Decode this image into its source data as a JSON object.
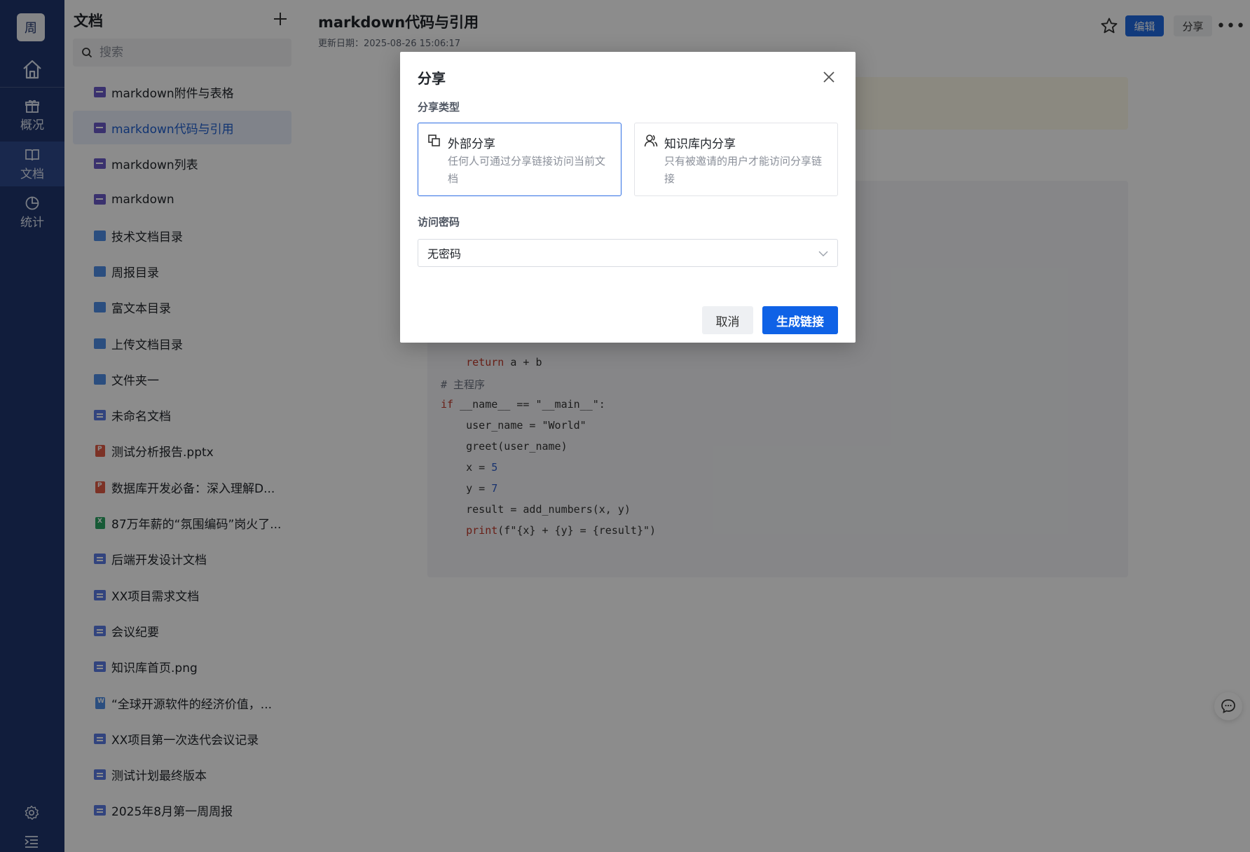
{
  "rail": {
    "avatar_text": "周",
    "nav": [
      {
        "label": "概况",
        "icon": "gift-icon"
      },
      {
        "label": "文档",
        "icon": "book-icon",
        "active": true
      },
      {
        "label": "统计",
        "icon": "pie-chart-icon"
      }
    ]
  },
  "panel": {
    "title": "文档",
    "search_placeholder": "搜索",
    "items": [
      {
        "label": "markdown附件与表格",
        "type": "md"
      },
      {
        "label": "markdown代码与引用",
        "type": "md",
        "active": true
      },
      {
        "label": "markdown列表",
        "type": "md"
      },
      {
        "label": "markdown",
        "type": "md"
      },
      {
        "label": "技术文档目录",
        "type": "folder"
      },
      {
        "label": "周报目录",
        "type": "folder"
      },
      {
        "label": "富文本目录",
        "type": "folder"
      },
      {
        "label": "上传文档目录",
        "type": "folder"
      },
      {
        "label": "文件夹一",
        "type": "folder"
      },
      {
        "label": "未命名文档",
        "type": "doc"
      },
      {
        "label": "测试分析报告.pptx",
        "type": "ppt"
      },
      {
        "label": "数据库开发必备：深入理解D...",
        "type": "ppt"
      },
      {
        "label": "87万年薪的“氛围编码”岗火了...",
        "type": "xls"
      },
      {
        "label": "后端开发设计文档",
        "type": "doc"
      },
      {
        "label": "XX项目需求文档",
        "type": "doc"
      },
      {
        "label": "会议纪要",
        "type": "doc"
      },
      {
        "label": "知识库首页.png",
        "type": "doc"
      },
      {
        "label": "“全球开源软件的经济价值，...",
        "type": "word"
      },
      {
        "label": "XX项目第一次迭代会议记录",
        "type": "doc"
      },
      {
        "label": "测试计划最终版本",
        "type": "doc"
      },
      {
        "label": "2025年8月第一周周报",
        "type": "doc"
      }
    ]
  },
  "document": {
    "title": "markdown代码与引用",
    "updated": "更新日期：2025-08-26 15:06:17",
    "edit_label": "编辑",
    "share_label": "分享",
    "code_lines": [
      {
        "text": "    return a + b",
        "kind": "return"
      },
      {
        "text": "# 主程序",
        "kind": "comment"
      },
      {
        "text": "if __name__ == \"__main__\":",
        "kind": "if"
      },
      {
        "text": "    user_name = \"World\"",
        "kind": "plain"
      },
      {
        "text": "    greet(user_name)",
        "kind": "plain"
      },
      {
        "text": "    x = 5",
        "kind": "num"
      },
      {
        "text": "    y = 7",
        "kind": "num"
      },
      {
        "text": "    result = add_numbers(x, y)",
        "kind": "plain"
      },
      {
        "text": "    print(f\"{x} + {y} = {result}\")",
        "kind": "print"
      }
    ]
  },
  "modal": {
    "title": "分享",
    "type_label": "分享类型",
    "options": [
      {
        "title": "外部分享",
        "desc": "任何人可通过分享链接访问当前文档",
        "selected": true
      },
      {
        "title": "知识库内分享",
        "desc": "只有被邀请的用户才能访问分享链接",
        "selected": false
      }
    ],
    "password_label": "访问密码",
    "password_value": "无密码",
    "cancel_label": "取消",
    "generate_label": "生成链接"
  },
  "colors": {
    "rail_bg": "#20366d",
    "primary": "#0f62e6",
    "overlay": "rgba(0,0,0,0.45)"
  }
}
